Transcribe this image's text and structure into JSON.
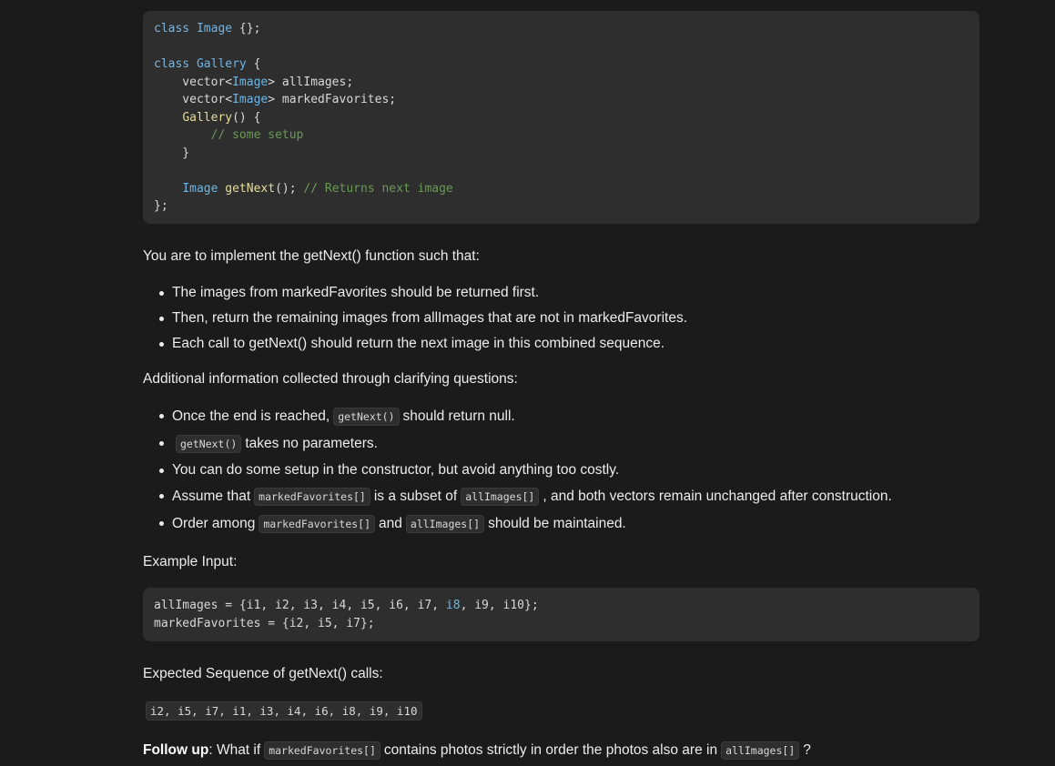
{
  "code_main": {
    "line1": {
      "kw": "class",
      "name": "Image",
      "rest": " {};"
    },
    "line3": {
      "kw": "class",
      "name": "Gallery",
      "rest": " {"
    },
    "line4": {
      "a": "    vector<",
      "t": "Image",
      "b": "> allImages;"
    },
    "line5": {
      "a": "    vector<",
      "t": "Image",
      "b": "> markedFavorites;"
    },
    "line6": {
      "fn": "Gallery",
      "rest": "() {"
    },
    "line7": {
      "comment": "// some setup"
    },
    "line8": {
      "text": "    }"
    },
    "line10": {
      "t": "Image",
      "fn": "getNext",
      "rest": "(); ",
      "comment": "// Returns next image"
    },
    "line11": {
      "text": "};"
    }
  },
  "intro_text": "You are to implement the getNext() function such that:",
  "rules": [
    "The images from markedFavorites should be returned first.",
    "Then, return the remaining images from allImages that are not in markedFavorites.",
    "Each call to getNext() should return the next image in this combined sequence."
  ],
  "additional_heading": "Additional information collected through clarifying questions:",
  "additional": {
    "item1": {
      "a": "Once the end is reached,",
      "code": "getNext()",
      "b": "should return null."
    },
    "item2": {
      "code": "getNext()",
      "b": "takes no parameters."
    },
    "item3": {
      "a": "You can do some setup in the constructor, but avoid anything too costly."
    },
    "item4": {
      "a": "Assume that",
      "code1": "markedFavorites[]",
      "b": "is a subset of",
      "code2": "allImages[]",
      "c": ", and both vectors remain unchanged after construction."
    },
    "item5": {
      "a": "Order among",
      "code1": "markedFavorites[]",
      "b": "and",
      "code2": "allImages[]",
      "c": "should be maintained."
    }
  },
  "example_heading": "Example Input:",
  "example_code": {
    "line1_a": "allImages = {i1, i2, i3, i4, i5, i6, i7, ",
    "line1_hl": "i8",
    "line1_b": ", i9, i10};",
    "line2": "markedFavorites = {i2, i5, i7};"
  },
  "expected_heading": "Expected Sequence of getNext() calls:",
  "expected_sequence": "i2, i5, i7, i1, i3, i4, i6, i8, i9, i10",
  "followup": {
    "label": "Follow up",
    "a": ": What if",
    "code1": "markedFavorites[]",
    "b": "contains photos strictly in order the photos also are in",
    "code2": "allImages[]",
    "c": "?"
  }
}
